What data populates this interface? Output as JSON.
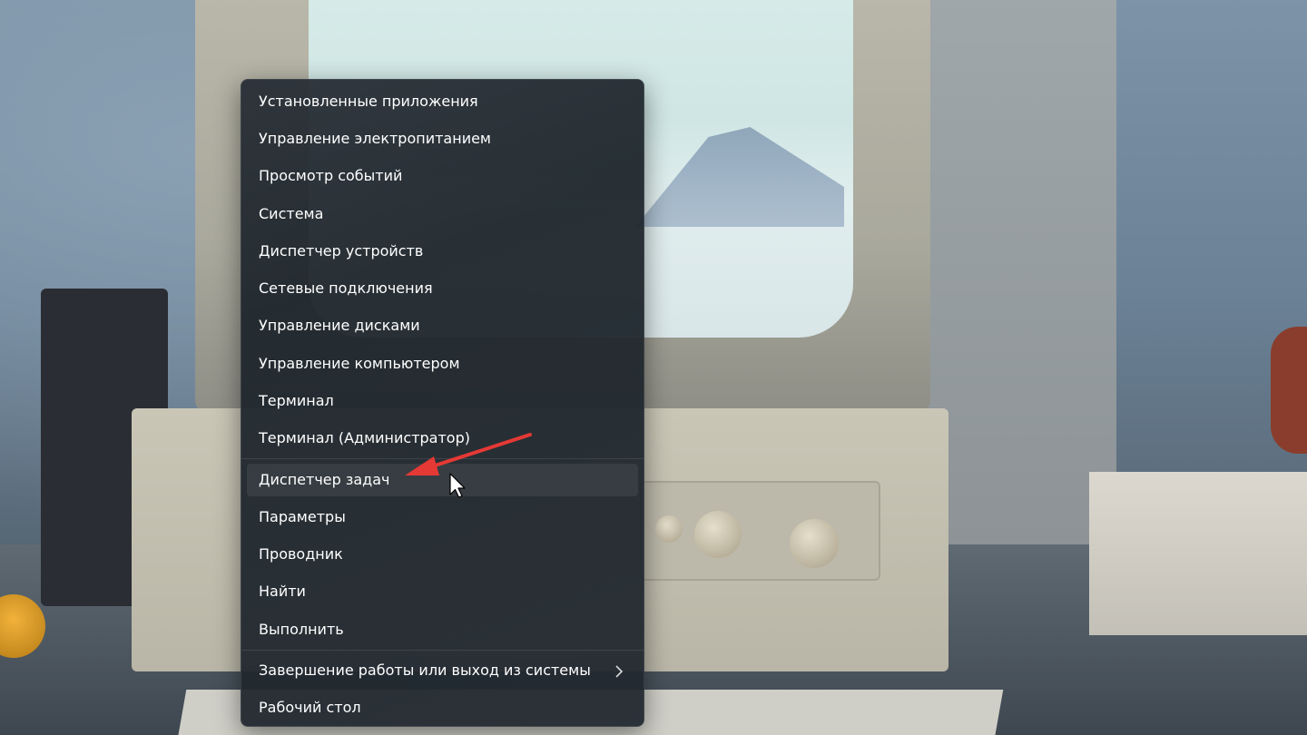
{
  "menu": {
    "items": [
      {
        "label": "Установленные приложения"
      },
      {
        "label": "Управление электропитанием"
      },
      {
        "label": "Просмотр событий"
      },
      {
        "label": "Система"
      },
      {
        "label": "Диспетчер устройств"
      },
      {
        "label": "Сетевые подключения"
      },
      {
        "label": "Управление дисками"
      },
      {
        "label": "Управление компьютером"
      },
      {
        "label": "Терминал"
      },
      {
        "label": "Терминал (Администратор)"
      },
      {
        "label": "Диспетчер задач",
        "highlighted": true
      },
      {
        "label": "Параметры"
      },
      {
        "label": "Проводник"
      },
      {
        "label": "Найти"
      },
      {
        "label": "Выполнить"
      },
      {
        "label": "Завершение работы или выход из системы",
        "has_submenu": true
      },
      {
        "label": "Рабочий стол"
      }
    ],
    "submenu_icon": "chevron-right-icon"
  },
  "annotation": {
    "color": "#e53935",
    "icon": "arrow-icon"
  },
  "cursor": {
    "icon": "mouse-pointer-icon"
  }
}
